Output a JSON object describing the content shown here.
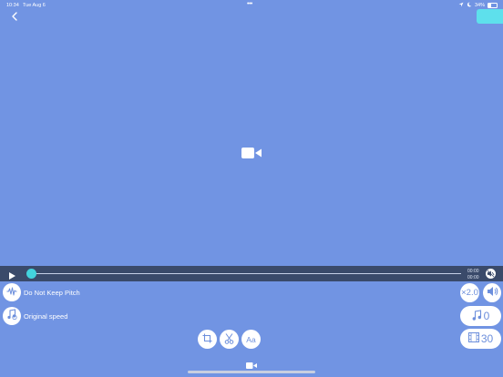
{
  "status_bar": {
    "time": "10:34",
    "date": "Tue Aug 6",
    "dots": "•••",
    "battery": "34%"
  },
  "player": {
    "current_time": "00:00",
    "total_time": "00:00",
    "progress": 0.0
  },
  "options": {
    "pitch_label": "Do Not Keep Pitch",
    "speed_label": "Original speed",
    "speed_multiplier": "×2.0",
    "music_count": "0",
    "frame_count": "30"
  },
  "tools": {
    "text_label": "Aa"
  },
  "colors": {
    "background": "#7194e3",
    "accent": "#5ee0ec",
    "scrubber_knob": "#43d2dd",
    "playback_bar": "#3a4a6a"
  },
  "icons": [
    "back-chevron-icon",
    "video-camera-icon",
    "play-icon",
    "mute-icon",
    "waveform-icon",
    "music-note-icon",
    "speaker-icon",
    "crop-icon",
    "scissors-icon",
    "film-frame-icon"
  ]
}
